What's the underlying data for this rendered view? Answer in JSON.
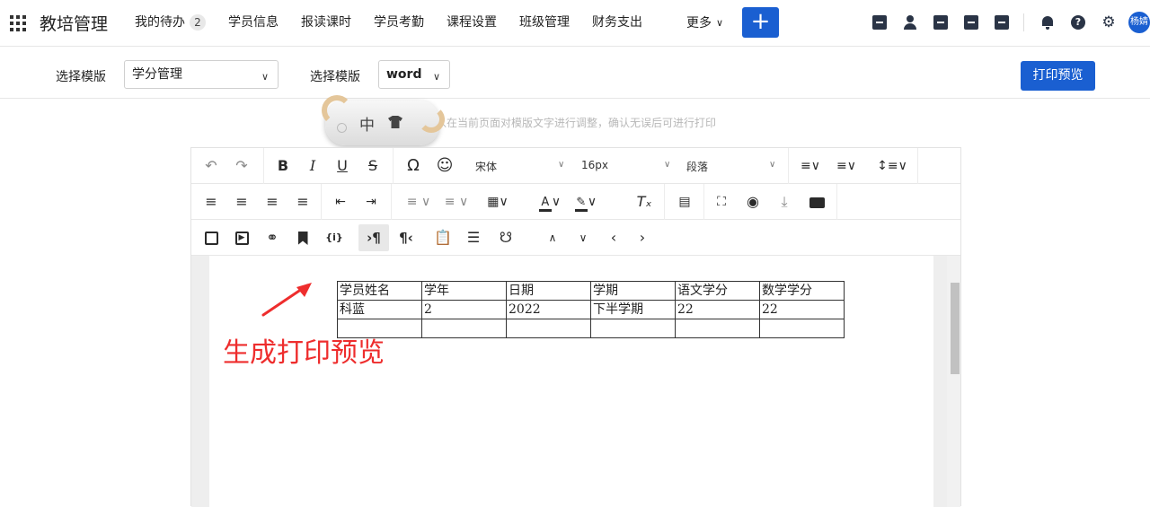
{
  "header": {
    "app_title": "教培管理",
    "nav": [
      {
        "label": "我的待办",
        "badge": "2"
      },
      {
        "label": "学员信息"
      },
      {
        "label": "报读课时"
      },
      {
        "label": "学员考勤"
      },
      {
        "label": "课程设置"
      },
      {
        "label": "班级管理"
      },
      {
        "label": "财务支出"
      }
    ],
    "more_label": "更多",
    "plus_label": "+",
    "avatar_text": "杨婧",
    "accent_color": "#1a5fd1"
  },
  "filters": {
    "template_label_1": "选择模版",
    "template_value_1": "学分管理",
    "template_label_2": "选择模版",
    "template_value_2": "word",
    "print_preview_button": "打印预览"
  },
  "hint_text": "以在当前页面对模版文字进行调整，确认无误后可进行打印",
  "ime": {
    "mode_label": "中"
  },
  "toolbar": {
    "font_family": "宋体",
    "font_size": "16px",
    "paragraph": "段落"
  },
  "table": {
    "headers": [
      "学员姓名",
      "学年",
      "日期",
      "学期",
      "语文学分",
      "数学学分"
    ],
    "rows": [
      [
        "科蓝",
        "2",
        "2022",
        "下半学期",
        "22",
        "22"
      ],
      [
        "",
        "",
        "",
        "",
        "",
        ""
      ]
    ]
  },
  "annotation": {
    "text": "生成打印预览",
    "color": "#ee2d2d"
  }
}
